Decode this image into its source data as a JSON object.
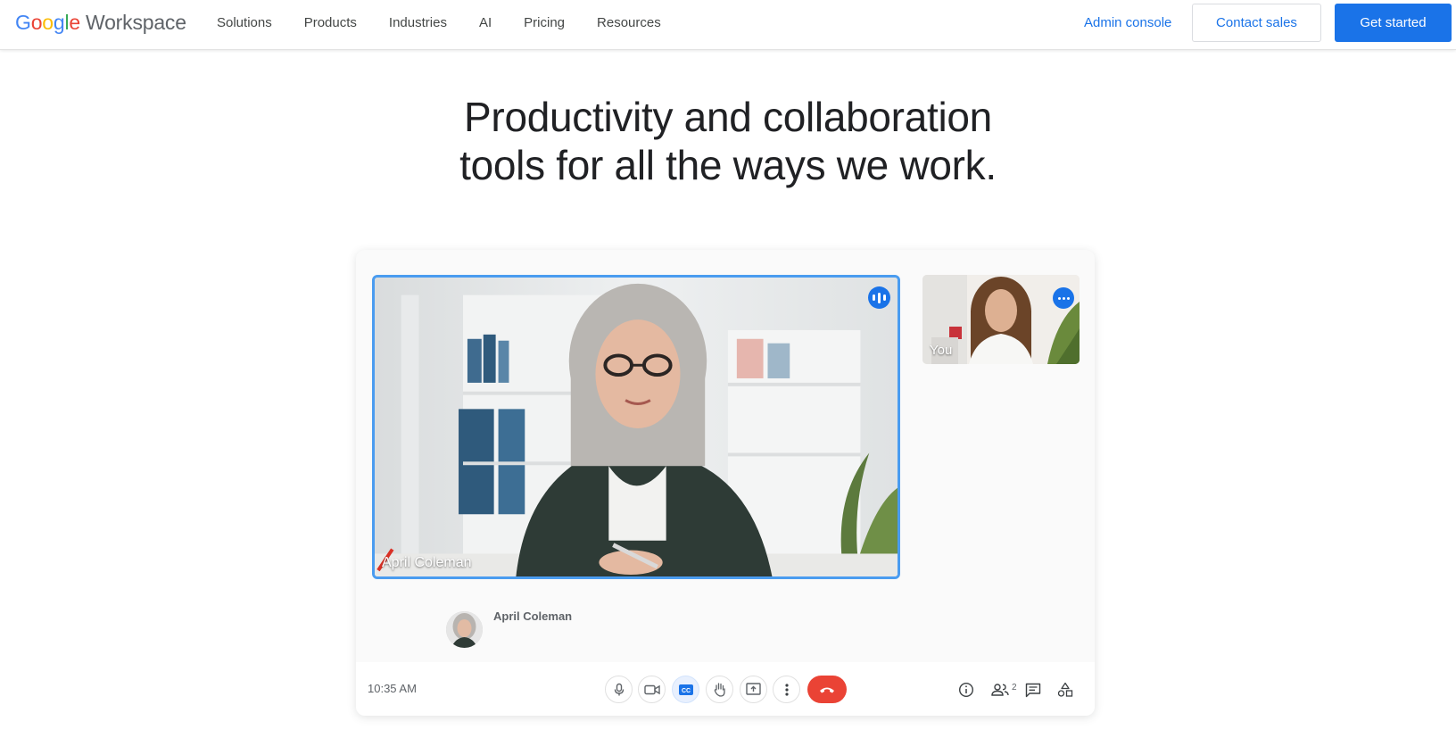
{
  "header": {
    "logo_google": "Google",
    "logo_product": "Workspace",
    "nav": [
      "Solutions",
      "Products",
      "Industries",
      "AI",
      "Pricing",
      "Resources"
    ],
    "admin_console": "Admin console",
    "contact_sales": "Contact sales",
    "get_started": "Get started"
  },
  "hero": {
    "line1": "Productivity and collaboration",
    "line2": "tools for all the ways we work."
  },
  "meet": {
    "main_participant": "April Coleman",
    "self_label": "You",
    "caption_speaker": "April Coleman",
    "time": "10:35 AM",
    "participants_count": "2",
    "controls": [
      "mic-icon",
      "camera-icon",
      "captions-icon",
      "raise-hand-icon",
      "present-icon",
      "more-vert-icon",
      "hangup-icon"
    ],
    "right_controls": [
      "info-icon",
      "people-icon",
      "chat-icon",
      "activities-icon"
    ]
  },
  "colors": {
    "accent": "#1a73e8",
    "hangup": "#ea4335",
    "speaking_border": "#4a9cf0"
  }
}
